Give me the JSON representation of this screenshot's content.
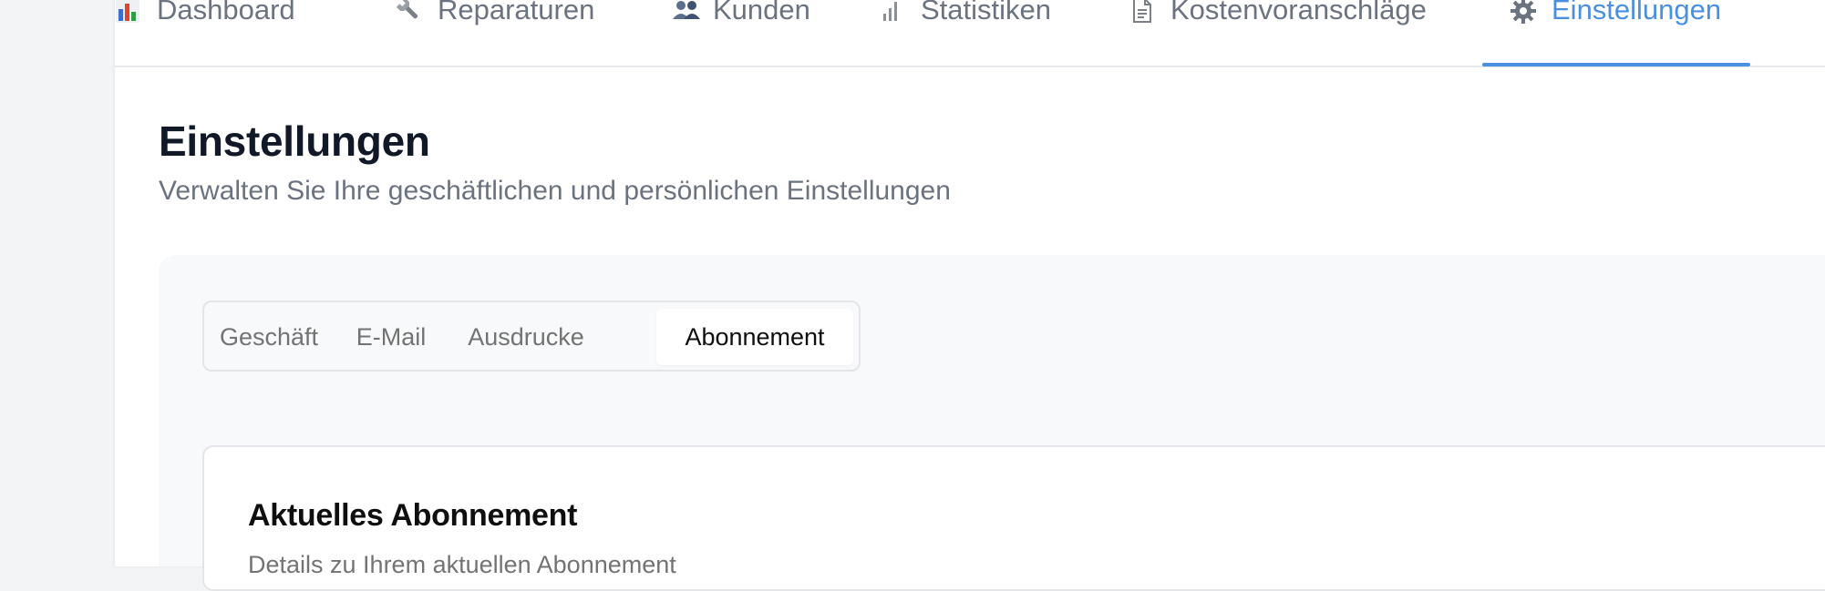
{
  "nav": {
    "items": [
      {
        "label": "Dashboard",
        "icon": "bar-chart-icon"
      },
      {
        "label": "Reparaturen",
        "icon": "wrench-icon"
      },
      {
        "label": "Kunden",
        "icon": "users-icon"
      },
      {
        "label": "Statistiken",
        "icon": "signal-icon"
      },
      {
        "label": "Kostenvoranschläge",
        "icon": "document-icon"
      },
      {
        "label": "Einstellungen",
        "icon": "gear-icon"
      }
    ],
    "active": "Einstellungen"
  },
  "page": {
    "title": "Einstellungen",
    "subtitle": "Verwalten Sie Ihre geschäftlichen und persönlichen Einstellungen"
  },
  "settings_tabs": {
    "items": [
      "Geschäft",
      "E-Mail",
      "Ausdrucke",
      "Abonnement"
    ],
    "active": "Abonnement"
  },
  "subscription_card": {
    "title": "Aktuelles Abonnement",
    "description": "Details zu Ihrem aktuellen Abonnement"
  },
  "colors": {
    "accent": "#4a90e2",
    "nav_text": "#6b7280",
    "title_text": "#111827",
    "panel_bg": "#f8f9fa"
  }
}
